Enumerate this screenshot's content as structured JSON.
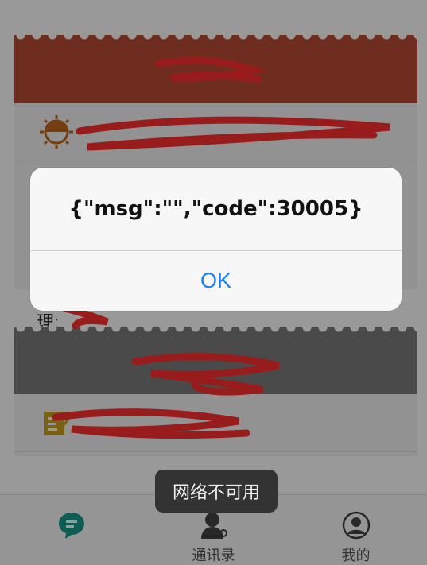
{
  "cards": [
    {
      "header_text": "",
      "row_text": ""
    },
    {
      "header_text": "",
      "row_text": ""
    }
  ],
  "manager_label": "理:",
  "alert": {
    "message": "{\"msg\":\"\",\"code\":30005}",
    "ok_label": "OK",
    "ok_color": "#1a7ef5"
  },
  "toast": {
    "text": "网络不可用"
  },
  "tabbar": {
    "tabs": [
      {
        "icon": "chat-bubble-icon",
        "label": "",
        "color": "#1a9a8a"
      },
      {
        "icon": "contacts-icon",
        "label": "通讯录"
      },
      {
        "icon": "profile-icon",
        "label": "我的"
      }
    ]
  },
  "colors": {
    "header_red": "#b94c35",
    "header_gray": "#7c7c7c",
    "redaction": "#ff3030"
  }
}
